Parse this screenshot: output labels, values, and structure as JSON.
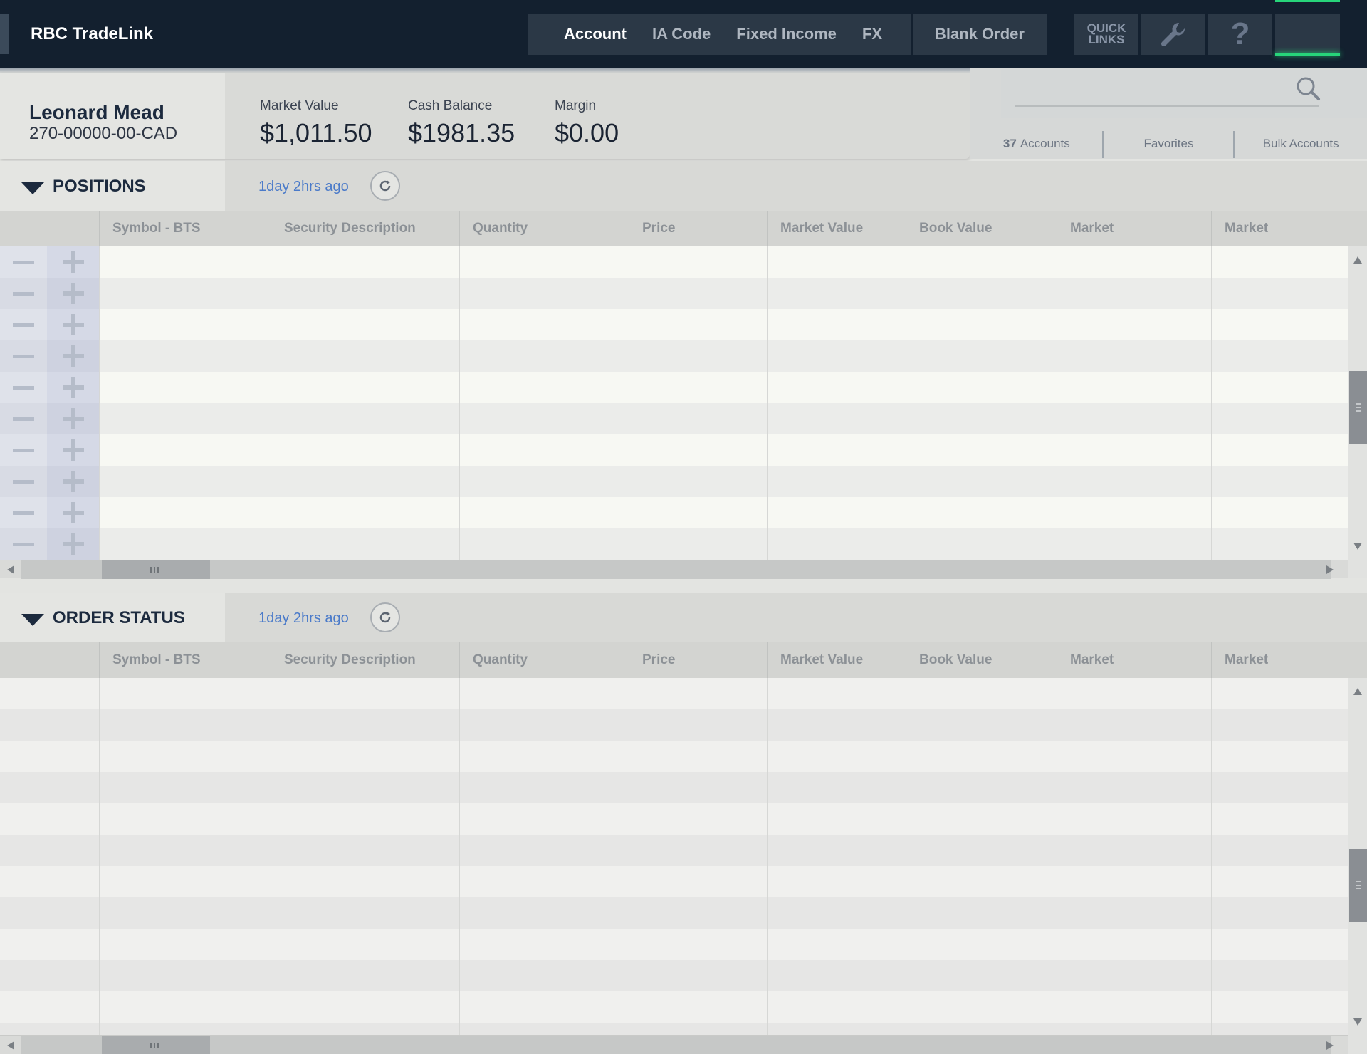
{
  "header": {
    "brand": "RBC TradeLink",
    "nav": [
      "Account",
      "IA Code",
      "Fixed Income",
      "FX"
    ],
    "active_nav": "Account",
    "blank_order": "Blank Order",
    "quick_links_line1": "QUICK",
    "quick_links_line2": "LINKS",
    "help_glyph": "?",
    "accent_color": "#27d57a",
    "header_color": "#13202f"
  },
  "account": {
    "name": "Leonard Mead",
    "number": "270-00000-00-CAD",
    "market_value_label": "Market Value",
    "market_value": "$1,011.50",
    "cash_balance_label": "Cash Balance",
    "cash_balance": "$1981.35",
    "margin_label": "Margin",
    "margin": "$0.00"
  },
  "account_search": {
    "placeholder": "",
    "tabs": {
      "accounts_count": "37",
      "accounts_label": "Accounts",
      "favorites": "Favorites",
      "bulk": "Bulk Accounts"
    }
  },
  "positions": {
    "title": "POSITIONS",
    "updated": "1day 2hrs ago",
    "columns": [
      "Symbol - BTS",
      "Security Description",
      "Quantity",
      "Price",
      "Market Value",
      "Book Value",
      "Market",
      "Market"
    ],
    "row_count": 10
  },
  "order_status": {
    "title": "ORDER STATUS",
    "updated": "1day 2hrs ago",
    "columns": [
      "Symbol - BTS",
      "Security Description",
      "Quantity",
      "Price",
      "Market Value",
      "Book Value",
      "Market",
      "Market"
    ],
    "row_count": 12
  }
}
